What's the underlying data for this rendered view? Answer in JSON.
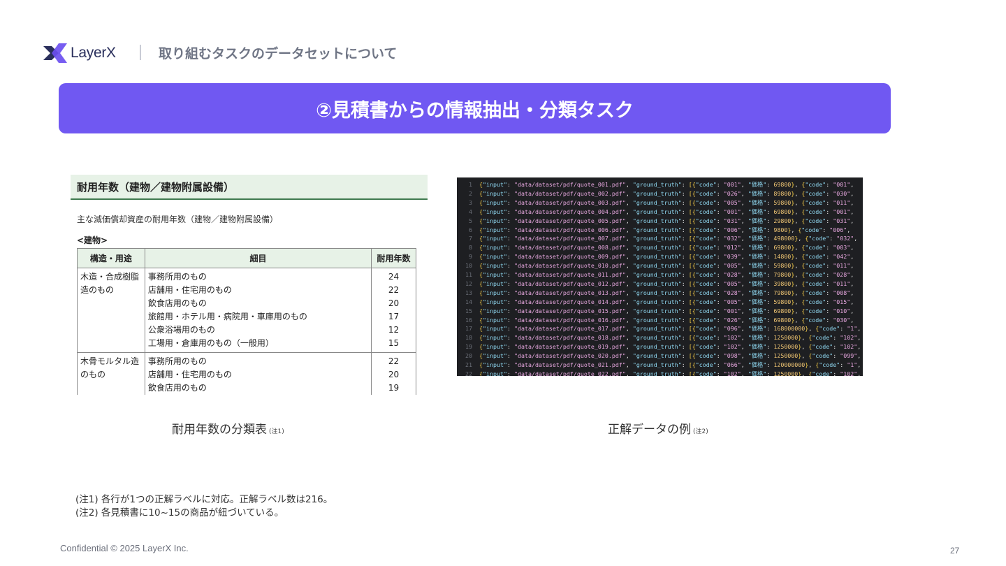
{
  "header": {
    "logo_text": "LayerX",
    "title": "取り組むタスクのデータセットについて"
  },
  "banner": {
    "title": "②見積書からの情報抽出・分類タスク"
  },
  "doc": {
    "title": "耐用年数（建物／建物附属設備）",
    "subtitle": "主な減価償却資産の耐用年数（建物／建物附属設備）",
    "section_tag": "<建物>",
    "columns": [
      "構造・用途",
      "細目",
      "耐用年数"
    ],
    "groups": [
      {
        "structure": [
          "木造・合成樹脂",
          "造のもの"
        ],
        "items": [
          {
            "detail": "事務所用のもの",
            "years": "24"
          },
          {
            "detail": "店舗用・住宅用のもの",
            "years": "22"
          },
          {
            "detail": "飲食店用のもの",
            "years": "20"
          },
          {
            "detail": "旅館用・ホテル用・病院用・車庫用のもの",
            "years": "17"
          },
          {
            "detail": "公衆浴場用のもの",
            "years": "12"
          },
          {
            "detail": "工場用・倉庫用のもの（一般用）",
            "years": "15"
          }
        ]
      },
      {
        "structure": [
          "木骨モルタル造",
          "のもの"
        ],
        "items": [
          {
            "detail": "事務所用のもの",
            "years": "22"
          },
          {
            "detail": "店舗用・住宅用のもの",
            "years": "20"
          },
          {
            "detail": "飲食店用のもの",
            "years": "19"
          }
        ]
      }
    ]
  },
  "code": {
    "lines": [
      {
        "n": "1",
        "file": "quote_001.pdf",
        "code": "001",
        "price": "69800",
        "next": "001"
      },
      {
        "n": "2",
        "file": "quote_002.pdf",
        "code": "026",
        "price": "89800",
        "next": "030"
      },
      {
        "n": "3",
        "file": "quote_003.pdf",
        "code": "005",
        "price": "59800",
        "next": "011"
      },
      {
        "n": "4",
        "file": "quote_004.pdf",
        "code": "001",
        "price": "69800",
        "next": "001"
      },
      {
        "n": "5",
        "file": "quote_005.pdf",
        "code": "031",
        "price": "29800",
        "next": "031"
      },
      {
        "n": "6",
        "file": "quote_006.pdf",
        "code": "006",
        "price": "9800",
        "next": "006"
      },
      {
        "n": "7",
        "file": "quote_007.pdf",
        "code": "032",
        "price": "498000",
        "next": "032"
      },
      {
        "n": "8",
        "file": "quote_008.pdf",
        "code": "012",
        "price": "69800",
        "next": "003"
      },
      {
        "n": "9",
        "file": "quote_009.pdf",
        "code": "039",
        "price": "14800",
        "next": "042"
      },
      {
        "n": "10",
        "file": "quote_010.pdf",
        "code": "005",
        "price": "59800",
        "next": "011"
      },
      {
        "n": "11",
        "file": "quote_011.pdf",
        "code": "028",
        "price": "79800",
        "next": "028"
      },
      {
        "n": "12",
        "file": "quote_012.pdf",
        "code": "005",
        "price": "39800",
        "next": "011"
      },
      {
        "n": "13",
        "file": "quote_013.pdf",
        "code": "028",
        "price": "79800",
        "next": "008"
      },
      {
        "n": "14",
        "file": "quote_014.pdf",
        "code": "005",
        "price": "59800",
        "next": "015"
      },
      {
        "n": "15",
        "file": "quote_015.pdf",
        "code": "001",
        "price": "69800",
        "next": "010"
      },
      {
        "n": "16",
        "file": "quote_016.pdf",
        "code": "026",
        "price": "69800",
        "next": "030"
      },
      {
        "n": "17",
        "file": "quote_017.pdf",
        "code": "096",
        "price": "168000000",
        "next": "1"
      },
      {
        "n": "18",
        "file": "quote_018.pdf",
        "code": "102",
        "price": "1250000",
        "next": "102"
      },
      {
        "n": "19",
        "file": "quote_019.pdf",
        "code": "102",
        "price": "1250000",
        "next": "102"
      },
      {
        "n": "20",
        "file": "quote_020.pdf",
        "code": "098",
        "price": "1250000",
        "next": "099"
      },
      {
        "n": "21",
        "file": "quote_021.pdf",
        "code": "066",
        "price": "120000000",
        "next": "1"
      },
      {
        "n": "22",
        "file": "quote_022.pdf",
        "code": "102",
        "price": "1250000",
        "next": "102"
      }
    ],
    "key_input": "\"input\"",
    "path_prefix": "data/dataset/pdf/",
    "key_gt": "\"ground_truth\"",
    "key_code": "\"code\"",
    "key_price": "\"価格\""
  },
  "captions": {
    "left": "耐用年数の分類表",
    "left_note": "(注1)",
    "right": "正解データの例",
    "right_note": "(注2)"
  },
  "notes": {
    "n1": "(注1) 各行が1つの正解ラベルに対応。正解ラベル数は216。",
    "n2": "(注2) 各見積書に10~15の商品が紐づいている。"
  },
  "footer": {
    "confidential": "Confidential © 2025 LayerX Inc.",
    "page": "27"
  },
  "colors": {
    "banner": "#7058f2",
    "logo_navy": "#2a2f5c",
    "logo_violet": "#6b4ff0",
    "table_header_bg": "#e7f2e7"
  }
}
